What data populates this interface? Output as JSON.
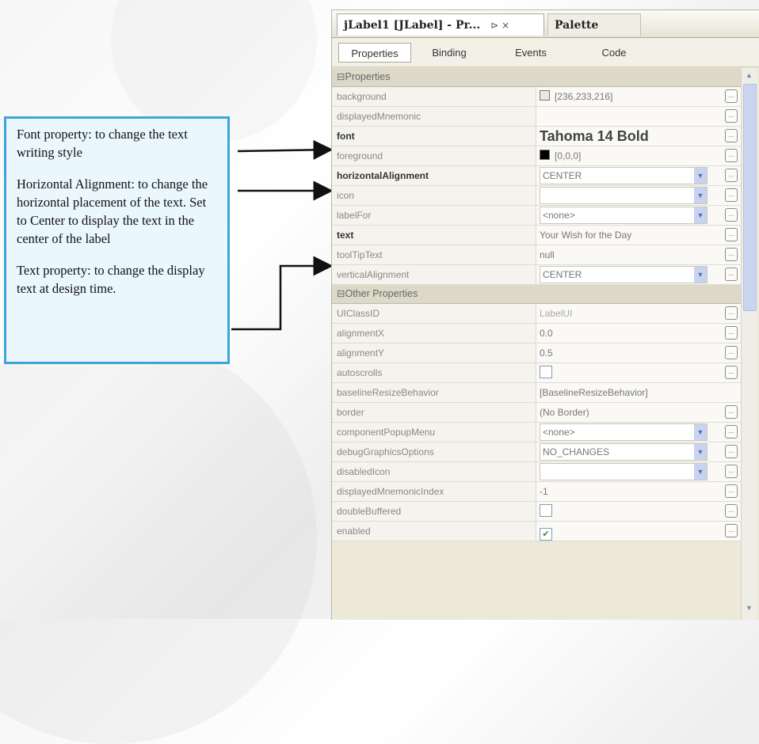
{
  "annotation": {
    "font_note": "Font property: to change the text writing style",
    "halign_note": "Horizontal Alignment: to change the horizontal placement of the text. Set to Center to display the text in the center of the label",
    "text_note": "Text property: to change the display text at design time."
  },
  "window": {
    "active_tab": "jLabel1 [JLabel] - Pr...",
    "inactive_tab": "Palette",
    "tab_controls": "⊳ ×"
  },
  "subtabs": [
    "Properties",
    "Binding",
    "Events",
    "Code"
  ],
  "sections": {
    "properties": "Properties",
    "other": "Other Properties"
  },
  "properties": [
    {
      "name": "background",
      "value": "[236,233,216]"
    },
    {
      "name": "displayedMnemonic",
      "value": ""
    },
    {
      "name": "font",
      "value": "Tahoma 14 Bold"
    },
    {
      "name": "foreground",
      "value": "[0,0,0]"
    },
    {
      "name": "horizontalAlignment",
      "value": "CENTER"
    },
    {
      "name": "icon",
      "value": ""
    },
    {
      "name": "labelFor",
      "value": "<none>"
    },
    {
      "name": "text",
      "value": "Your Wish for the Day"
    },
    {
      "name": "toolTipText",
      "value": "null"
    },
    {
      "name": "verticalAlignment",
      "value": "CENTER"
    }
  ],
  "other_properties": [
    {
      "name": "UIClassID",
      "value": "LabelUI"
    },
    {
      "name": "alignmentX",
      "value": "0.0"
    },
    {
      "name": "alignmentY",
      "value": "0.5"
    },
    {
      "name": "autoscrolls",
      "value": ""
    },
    {
      "name": "baselineResizeBehavior",
      "value": "[BaselineResizeBehavior]"
    },
    {
      "name": "border",
      "value": "(No Border)"
    },
    {
      "name": "componentPopupMenu",
      "value": "<none>"
    },
    {
      "name": "debugGraphicsOptions",
      "value": "NO_CHANGES"
    },
    {
      "name": "disabledIcon",
      "value": ""
    },
    {
      "name": "displayedMnemonicIndex",
      "value": "-1"
    },
    {
      "name": "doubleBuffered",
      "value": ""
    },
    {
      "name": "enabled",
      "value": ""
    }
  ],
  "colors": {
    "background_swatch": "#ece9d8",
    "foreground_swatch": "#000000",
    "annotation_border": "#3ba6d8",
    "annotation_fill": "#eaf7fd"
  },
  "icons": {
    "edit_button": "ellipsis-icon",
    "dropdown": "chevron-down-icon",
    "checkbox_checked": "check-icon"
  }
}
